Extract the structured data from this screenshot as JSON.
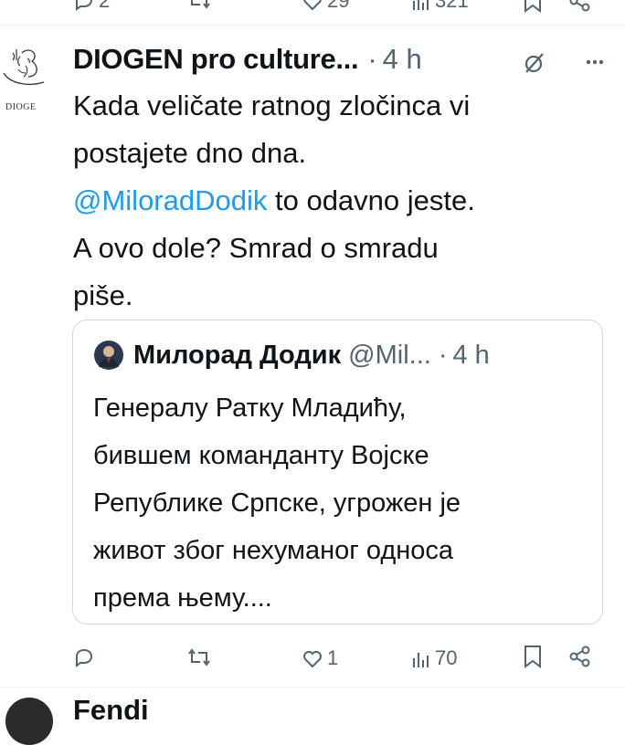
{
  "top_actions": {
    "reply_count": "2",
    "like_count": "29",
    "views_count": "321"
  },
  "tweet": {
    "display_name": "DIOGEN pro culture...",
    "separator": "·",
    "time": "4 h",
    "avatar_text": "DIOGE",
    "body_line1": "Kada veličate ratnog zločinca vi",
    "body_line2": "postajete dno dna.",
    "mention": "@MiloradDodik",
    "body_line3_rest": " to odavno jeste.",
    "body_line4": "A ovo dole? Smrad o smradu",
    "body_line5": "piše."
  },
  "quote": {
    "display_name": "Милорад Додик",
    "handle": "@Mil...",
    "separator": "·",
    "time": "4 h",
    "line1": "Генералу Ратку Младићу,",
    "line2": "бившем команданту Војске",
    "line3": "Републике Српске, угрожен је",
    "line4": "живот због нехуманог односа",
    "line5": "према њему...."
  },
  "actions": {
    "reply_count": "",
    "retweet_count": "",
    "like_count": "1",
    "views_count": "70"
  },
  "next_tweet": {
    "display_name": "Fendi"
  },
  "colors": {
    "text": "#0f1419",
    "secondary": "#536471",
    "link": "#1d9bf0",
    "border": "#cfd9de"
  }
}
